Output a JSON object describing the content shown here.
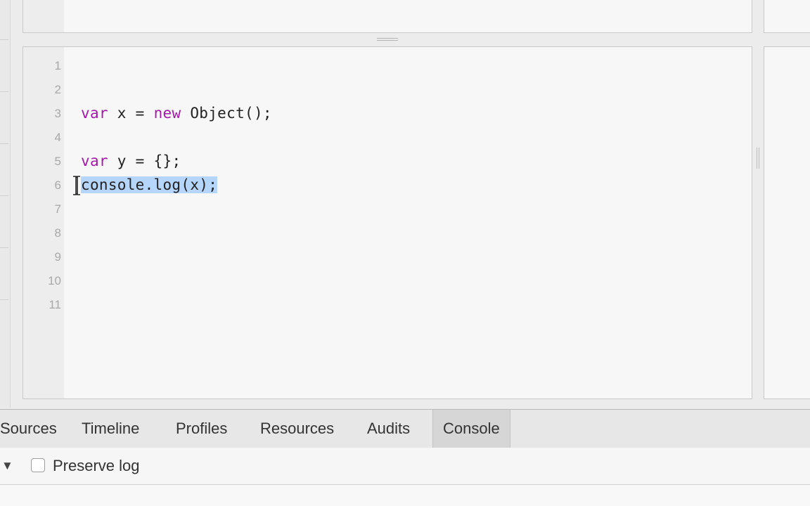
{
  "editor": {
    "lines": [
      {
        "num": "1",
        "tokens": []
      },
      {
        "num": "2",
        "tokens": []
      },
      {
        "num": "3",
        "tokens": [
          {
            "t": "var",
            "k": "kw"
          },
          {
            "t": " x = "
          },
          {
            "t": "new",
            "k": "kw"
          },
          {
            "t": " Object();"
          }
        ]
      },
      {
        "num": "4",
        "tokens": []
      },
      {
        "num": "5",
        "tokens": [
          {
            "t": "var",
            "k": "kw"
          },
          {
            "t": " y = {};"
          }
        ]
      },
      {
        "num": "6",
        "tokens": [
          {
            "t": "console.log(x);",
            "k": "sel"
          }
        ],
        "cursor": true
      },
      {
        "num": "7",
        "tokens": []
      },
      {
        "num": "8",
        "tokens": []
      },
      {
        "num": "9",
        "tokens": []
      },
      {
        "num": "10",
        "tokens": []
      },
      {
        "num": "11",
        "tokens": []
      }
    ]
  },
  "tabs": {
    "sources": "Sources",
    "timeline": "Timeline",
    "profiles": "Profiles",
    "resources": "Resources",
    "audits": "Audits",
    "console": "Console"
  },
  "console_bar": {
    "preserve_log_label": "Preserve log",
    "preserve_log_checked": false,
    "toggle_icon": "triangle-down-icon"
  },
  "icons": {
    "text_cursor": "i-beam-cursor-icon",
    "splitter": "splitter-grip-icon"
  },
  "colors": {
    "keyword": "#a31aa8",
    "selection": "#b5d5fb",
    "line_number": "#a8a8a8"
  }
}
